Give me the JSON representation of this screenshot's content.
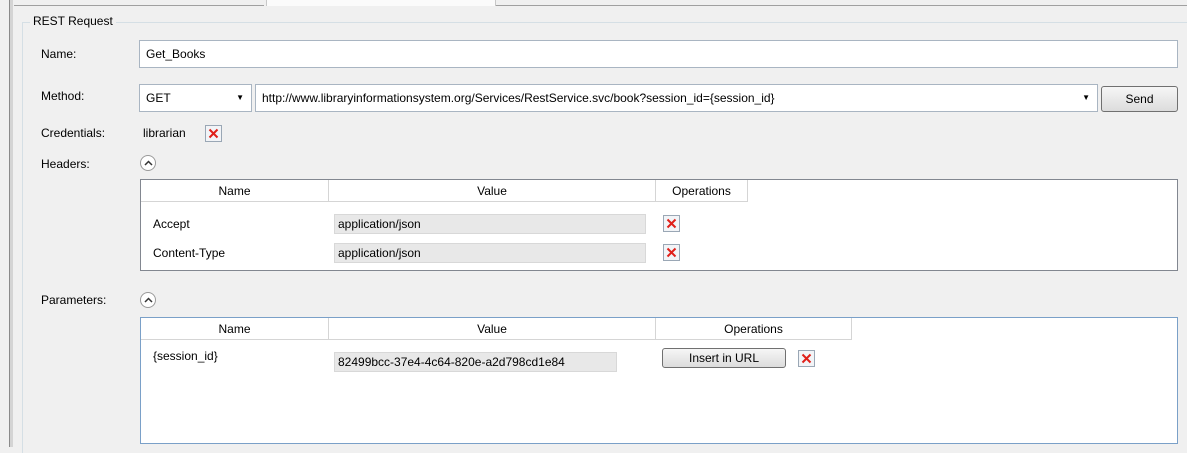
{
  "group_title": "REST Request",
  "name_label": "Name:",
  "name_value": "Get_Books",
  "method_label": "Method:",
  "method_value": "GET",
  "url_value": "http://www.libraryinformationsystem.org/Services/RestService.svc/book?session_id={session_id}",
  "send_label": "Send",
  "credentials_label": "Credentials:",
  "credentials_value": "librarian",
  "headers_label": "Headers:",
  "headers_columns": [
    "Name",
    "Value",
    "Operations"
  ],
  "headers_rows": [
    {
      "name": "Accept",
      "value": "application/json"
    },
    {
      "name": "Content-Type",
      "value": "application/json"
    }
  ],
  "parameters_label": "Parameters:",
  "parameters_columns": [
    "Name",
    "Value",
    "Operations"
  ],
  "parameters_rows": [
    {
      "name": "{session_id}",
      "value": "82499bcc-37e4-4c64-820e-a2d798cd1e84",
      "insert_label": "Insert in URL"
    }
  ],
  "colors": {
    "delete_icon": "#e0201a",
    "grid_border": "#828790",
    "value_bg": "#e8e8e8"
  },
  "icons": {
    "delete": "x-icon",
    "collapse": "chevron-up-icon",
    "dropdown": "dropdown-arrow-icon"
  }
}
